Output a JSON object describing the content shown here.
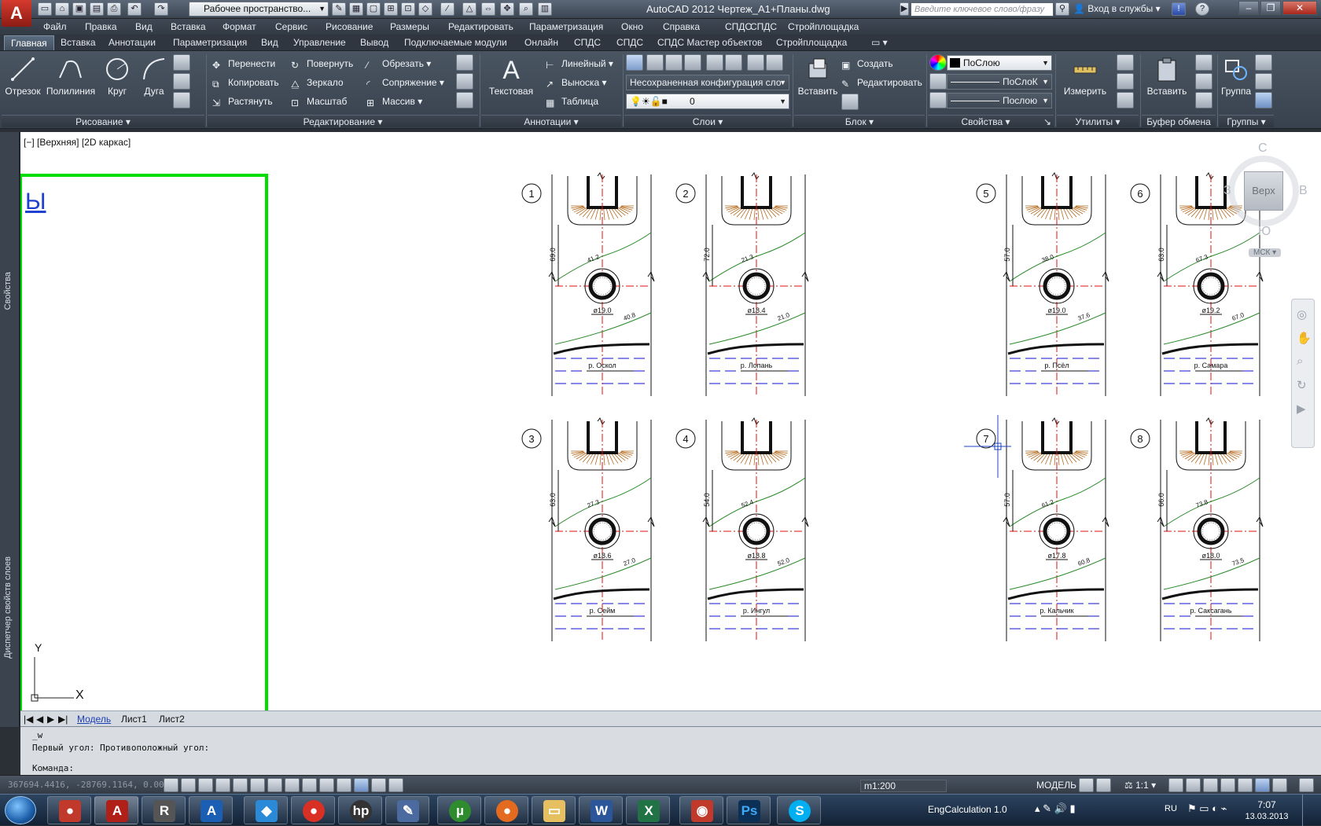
{
  "window": {
    "title": "AutoCAD 2012    Чертеж_A1+Планы.dwg",
    "workspace": "Рабочее пространство...",
    "search_placeholder": "Введите ключевое слово/фразу",
    "signin": "Вход в службы"
  },
  "menu": [
    "Файл",
    "Правка",
    "Вид",
    "Вставка",
    "Формат",
    "Сервис",
    "Рисование",
    "Размеры",
    "Редактировать",
    "Параметризация",
    "Окно",
    "Справка",
    "СПДС",
    "СПДС",
    "Стройплощадка"
  ],
  "ribbon_tabs": [
    "Главная",
    "Вставка",
    "Аннотации",
    "Параметризация",
    "Вид",
    "Управление",
    "Вывод",
    "Подключаемые модули",
    "Онлайн",
    "СПДС",
    "СПДС",
    "СПДС Мастер объектов",
    "Стройплощадка"
  ],
  "panels": {
    "draw": {
      "title": "Рисование",
      "line": "Отрезок",
      "polyline": "Полилиния",
      "circle": "Круг",
      "arc": "Дуга"
    },
    "modify": {
      "title": "Редактирование",
      "move": "Перенести",
      "rotate": "Повернуть",
      "trim": "Обрезать",
      "copy": "Копировать",
      "mirror": "Зеркало",
      "fillet": "Сопряжение",
      "stretch": "Растянуть",
      "scale": "Масштаб",
      "array": "Массив"
    },
    "annotation": {
      "title": "Аннотации",
      "text": "Текстовая",
      "linear": "Линейный",
      "leader": "Выноска",
      "table": "Таблица"
    },
    "layers": {
      "title": "Слои",
      "config": "Несохраненная конфигурация сло",
      "layer": "0"
    },
    "block": {
      "title": "Блок",
      "insert": "Вставить",
      "create": "Создать",
      "edit": "Редактировать"
    },
    "properties": {
      "title": "Свойства",
      "color": "ПоСлою",
      "linetype": "ПоСлоК",
      "lineweight": "Послою"
    },
    "utilities": {
      "title": "Утилиты",
      "measure": "Измерить"
    },
    "clipboard": {
      "title": "Буфер обмена",
      "paste": "Вставить"
    },
    "groups": {
      "title": "Группы",
      "group": "Группа"
    }
  },
  "palettes": {
    "properties": "Свойства",
    "layers": "Диспетчер свойств слоев"
  },
  "viewport": {
    "label": "[−] [Верхняя] [2D каркас]",
    "viewcube": {
      "top": "Верх",
      "n": "С",
      "s": "Ю",
      "w": "З",
      "e": "В",
      "ucs": "МСК"
    },
    "axis_x": "X",
    "axis_y": "Y",
    "cut_text": "Ы"
  },
  "drawings": [
    {
      "num": "1",
      "depth": "69.0",
      "elev_top": "41.2",
      "dia": "ø19.0",
      "elev_bot": "40.8",
      "river": "р. Оскол"
    },
    {
      "num": "2",
      "depth": "72.0",
      "elev_top": "21.3",
      "dia": "ø18.4",
      "elev_bot": "21.0",
      "river": "р. Лопань"
    },
    {
      "num": "3",
      "depth": "63.0",
      "elev_top": "27.3",
      "dia": "ø18.6",
      "elev_bot": "27.0",
      "river": "р. Сейм"
    },
    {
      "num": "4",
      "depth": "54.0",
      "elev_top": "52.4",
      "dia": "ø18.8",
      "elev_bot": "52.0",
      "river": "р. Ингул"
    },
    {
      "num": "5",
      "depth": "57.0",
      "elev_top": "38.0",
      "dia": "ø19.0",
      "elev_bot": "37.6",
      "river": "р. Псёл"
    },
    {
      "num": "6",
      "depth": "63.0",
      "elev_top": "67.3",
      "dia": "ø19.2",
      "elev_bot": "67.0",
      "river": "р. Самара"
    },
    {
      "num": "7",
      "depth": "57.0",
      "elev_top": "61.2",
      "dia": "ø17.8",
      "elev_bot": "60.8",
      "river": "р. Кальчик"
    },
    {
      "num": "8",
      "depth": "66.0",
      "elev_top": "73.8",
      "dia": "ø18.0",
      "elev_bot": "73.5",
      "river": "р. Саксагань"
    }
  ],
  "layout_tabs": [
    "Модель",
    "Лист1",
    "Лист2"
  ],
  "command": {
    "line1": "_w",
    "line2": "Первый угол: Противоположный угол:",
    "prompt": "Команда:"
  },
  "status": {
    "coords": "367694.4416, -28769.1164, 0.0000",
    "scale_readout": "m1:200",
    "space": "МОДЕЛЬ",
    "annoscale": "1:1"
  },
  "taskbar": {
    "app": "EngCalculation 1.0",
    "lang": "RU",
    "time": "7:07",
    "date": "13.03.2013"
  },
  "colors": {
    "accent_green": "#00dd00",
    "drawing_red": "#e01010",
    "water_blue": "#1010d0",
    "hatch_brown": "#b46a20",
    "ground_green": "#2a8a2a"
  }
}
